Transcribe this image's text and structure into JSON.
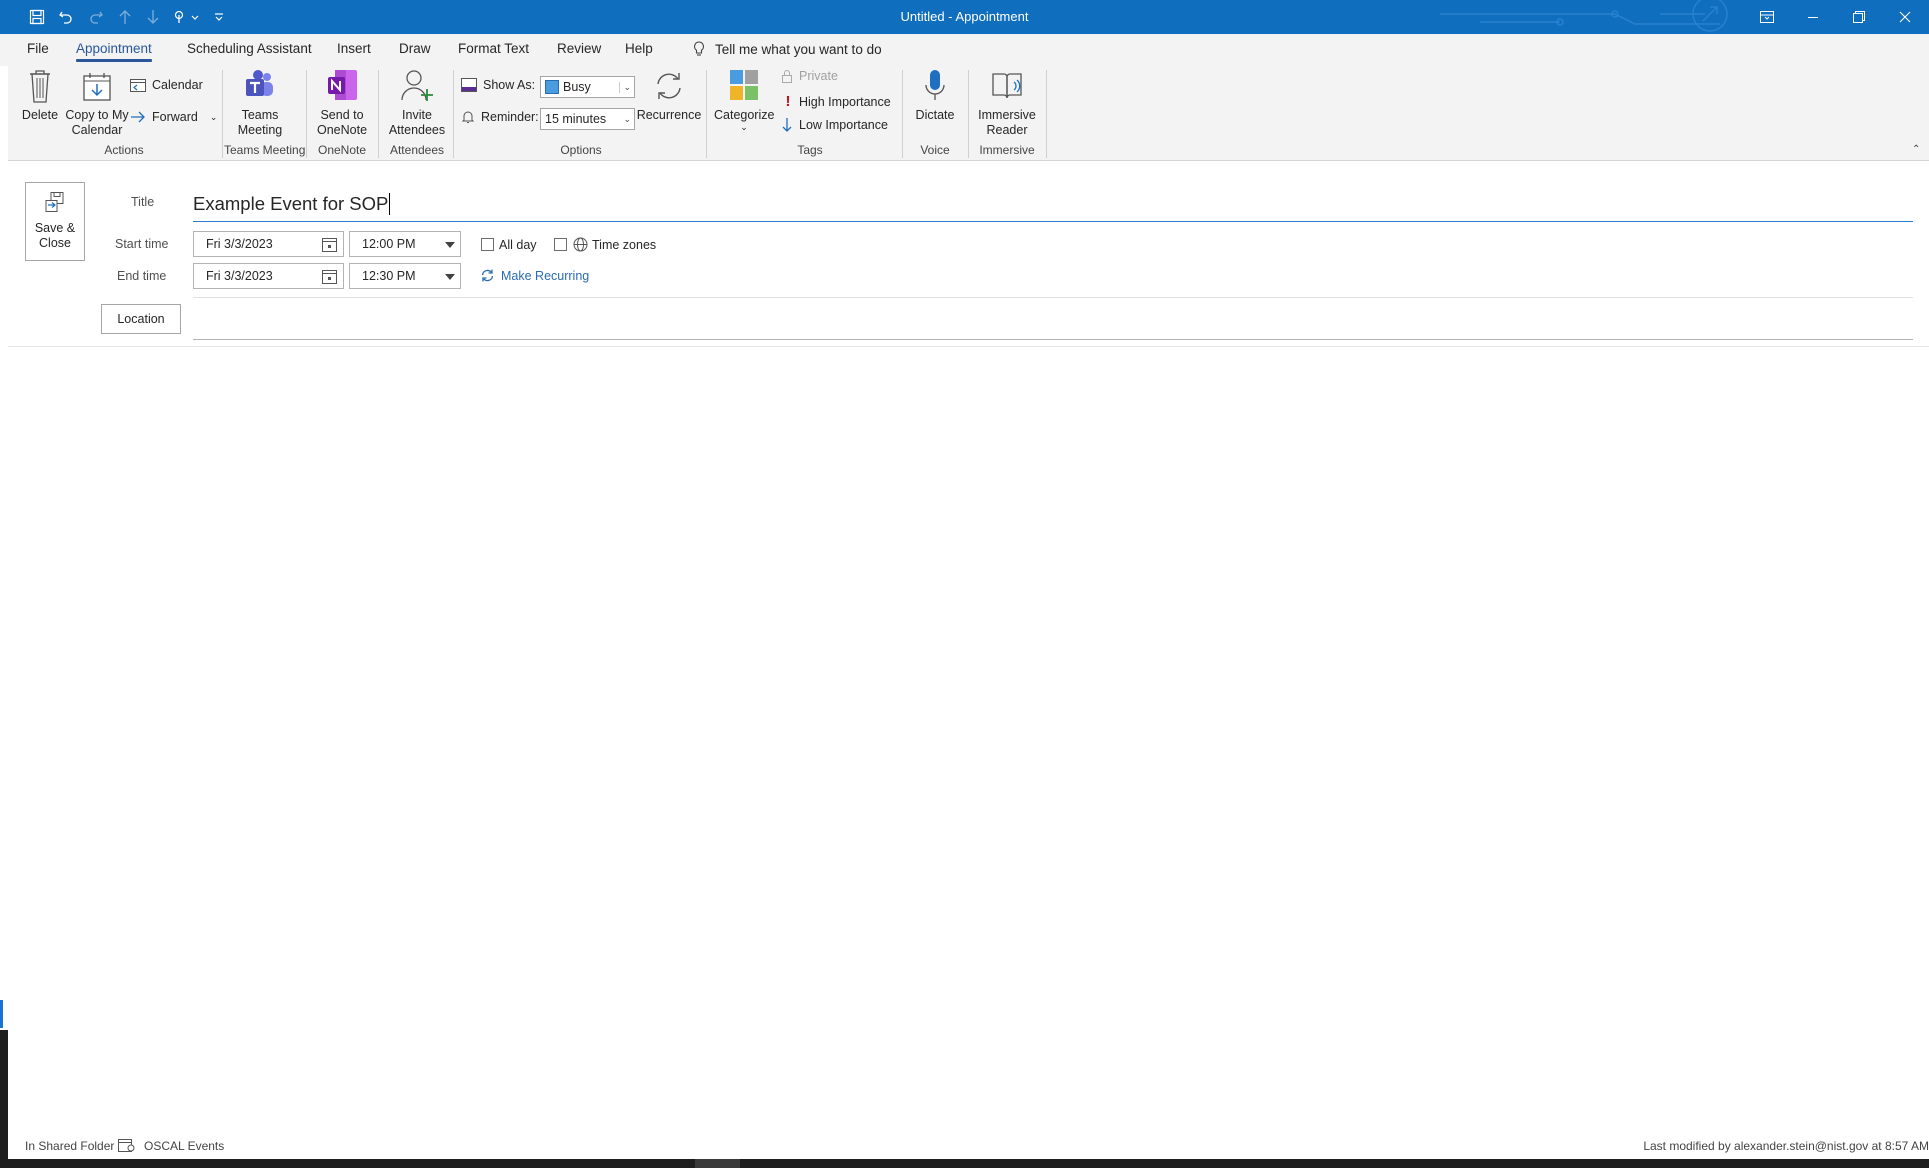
{
  "window": {
    "title": "Untitled  -  Appointment",
    "accent": "#106ebe"
  },
  "qat": {
    "icons": [
      "save-icon",
      "undo-icon",
      "redo-icon",
      "up-arrow-icon",
      "down-arrow-icon",
      "touch-mode-icon",
      "customize-icon"
    ]
  },
  "tabs": [
    "File",
    "Appointment",
    "Scheduling Assistant",
    "Insert",
    "Draw",
    "Format Text",
    "Review",
    "Help"
  ],
  "tell_me": "Tell me what you want to do",
  "ribbon": {
    "delete": "Delete",
    "copy_to_calendar": "Copy to My Calendar",
    "calendar": "Calendar",
    "forward": "Forward",
    "teams_meeting": "Teams Meeting",
    "send_to_onenote": "Send to OneNote",
    "invite_attendees": "Invite Attendees",
    "show_as_label": "Show As:",
    "show_as_value": "Busy",
    "reminder_label": "Reminder:",
    "reminder_value": "15 minutes",
    "recurrence": "Recurrence",
    "categorize": "Categorize",
    "private": "Private",
    "high_importance": "High Importance",
    "low_importance": "Low Importance",
    "dictate": "Dictate",
    "immersive_reader": "Immersive Reader",
    "groups": {
      "actions": "Actions",
      "teams_meeting": "Teams Meeting",
      "onenote": "OneNote",
      "attendees": "Attendees",
      "options": "Options",
      "tags": "Tags",
      "voice": "Voice",
      "immersive": "Immersive"
    }
  },
  "form": {
    "save_close": "Save & Close",
    "title_label": "Title",
    "title_value": "Example Event for SOP",
    "start_label": "Start time",
    "start_date": "Fri 3/3/2023",
    "start_time": "12:00 PM",
    "end_label": "End time",
    "end_date": "Fri 3/3/2023",
    "end_time": "12:30 PM",
    "all_day": "All day",
    "time_zones": "Time zones",
    "make_recurring": "Make Recurring",
    "location_button": "Location",
    "location_value": ""
  },
  "status": {
    "folder_prefix": "In Shared Folder",
    "folder_name": "OSCAL Events",
    "last_modified": "Last modified by alexander.stein@nist.gov at 8:57 AM"
  }
}
